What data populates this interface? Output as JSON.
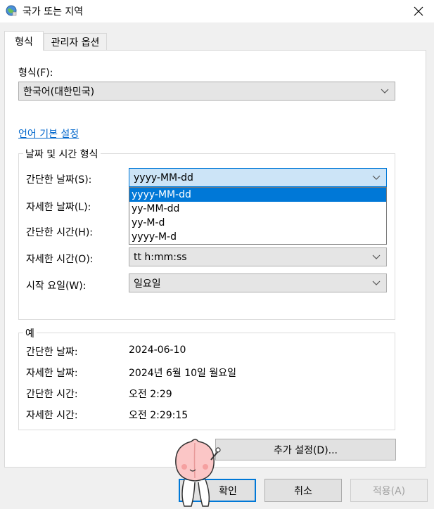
{
  "window": {
    "title": "국가 또는 지역",
    "close_label": "✕"
  },
  "tabs": [
    {
      "label": "형식",
      "active": true
    },
    {
      "label": "관리자 옵션",
      "active": false
    }
  ],
  "format": {
    "label": "형식(F):",
    "value": "한국어(대한민국)"
  },
  "language_link": "언어 기본 설정",
  "datetime_group": {
    "title": "날짜 및 시간 형식",
    "fields": [
      {
        "label": "간단한 날짜(S):",
        "value": "yyyy-MM-dd"
      },
      {
        "label": "자세한 날짜(L):",
        "value": ""
      },
      {
        "label": "간단한 시간(H):",
        "value": ""
      },
      {
        "label": "자세한 시간(O):",
        "value": "tt h:mm:ss"
      },
      {
        "label": "시작 요일(W):",
        "value": "일요일"
      }
    ],
    "dropdown_options": [
      "yyyy-MM-dd",
      "yy-MM-dd",
      "yy-M-d",
      "yyyy-M-d"
    ],
    "dropdown_selected_index": 0
  },
  "example_group": {
    "title": "예",
    "rows": [
      {
        "label": "간단한 날짜:",
        "value": "2024-06-10"
      },
      {
        "label": "자세한 날짜:",
        "value": "2024년 6월 10일 월요일"
      },
      {
        "label": "간단한 시간:",
        "value": "오전 2:29"
      },
      {
        "label": "자세한 시간:",
        "value": "오전 2:29:15"
      }
    ]
  },
  "buttons": {
    "additional": "추가 설정(D)...",
    "ok": "확인",
    "cancel": "취소",
    "apply": "적용(A)"
  },
  "colors": {
    "accent": "#0078d7",
    "link": "#0066cc",
    "selected_field": "#cce4f7"
  }
}
